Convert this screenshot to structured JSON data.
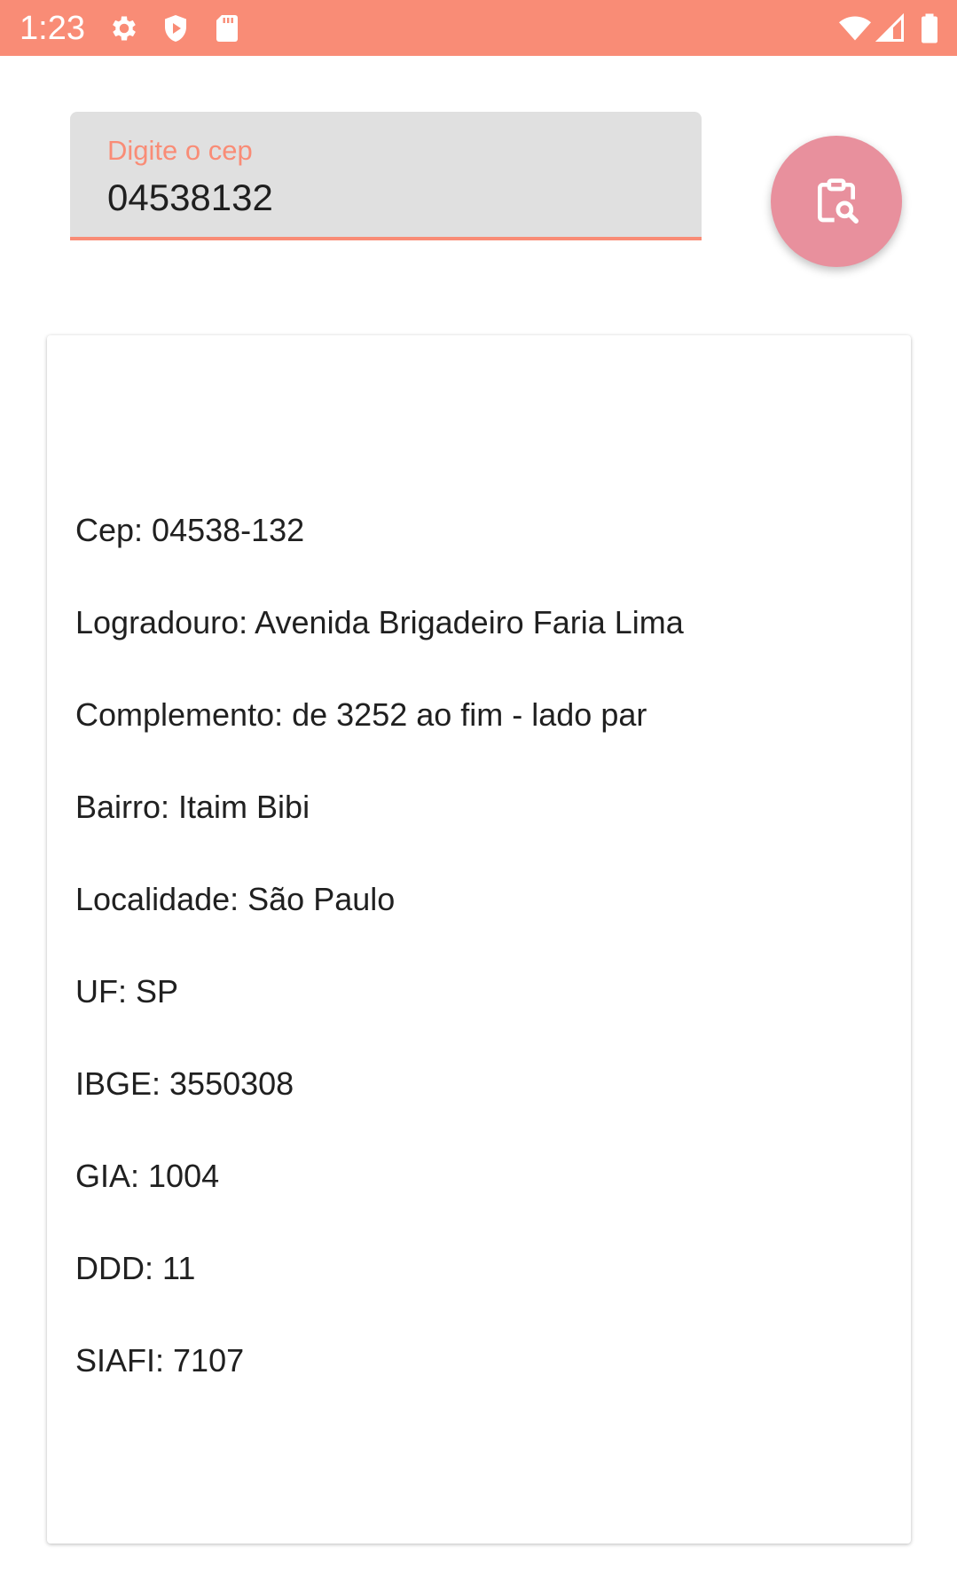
{
  "status_bar": {
    "time": "1:23",
    "background_color": "#f98c76",
    "left_icons": [
      "gear-icon",
      "shield-play-icon",
      "sd-card-icon"
    ],
    "right_icons": [
      "wifi-icon",
      "signal-icon",
      "battery-icon"
    ]
  },
  "search": {
    "label": "Digite o cep",
    "value": "04538132",
    "accent_color": "#f98c76"
  },
  "fab": {
    "icon": "clipboard-search-icon",
    "color": "#e8909d"
  },
  "result": {
    "lines": [
      "Cep: 04538-132",
      "Logradouro: Avenida Brigadeiro Faria Lima",
      "Complemento: de 3252 ao fim - lado par",
      "Bairro: Itaim Bibi",
      "Localidade: São Paulo",
      "UF: SP",
      "IBGE: 3550308",
      "GIA: 1004",
      "DDD: 11",
      "SIAFI: 7107"
    ]
  }
}
